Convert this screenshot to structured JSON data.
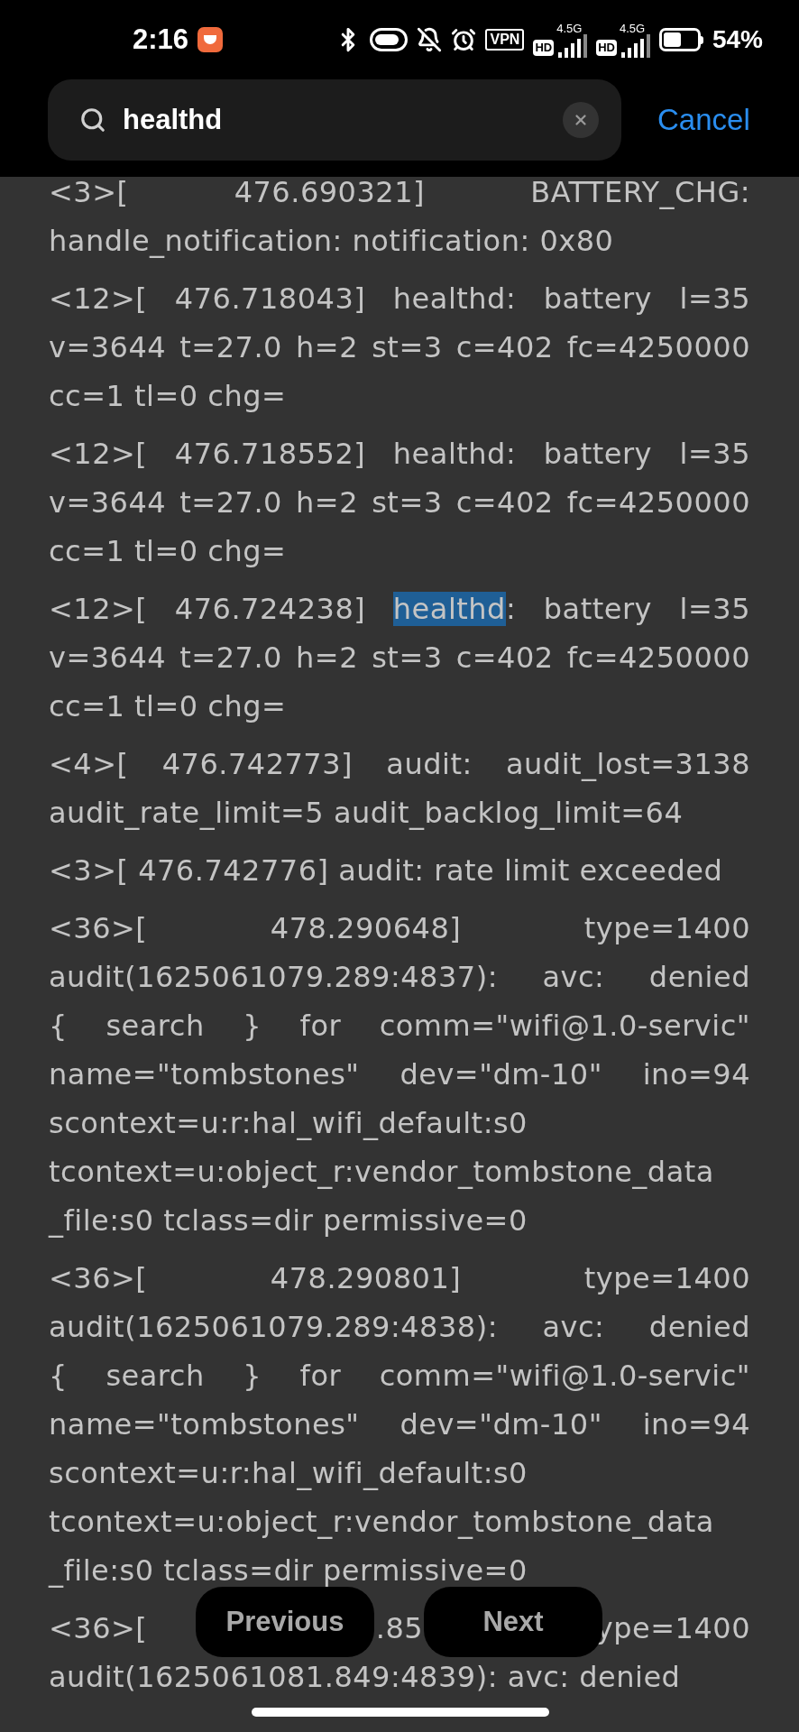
{
  "status_bar": {
    "time": "2:16",
    "vpn": "VPN",
    "sims": [
      {
        "hd": "HD",
        "network": "4.5G"
      },
      {
        "hd": "HD",
        "network": "4.5G"
      }
    ],
    "battery": "54%"
  },
  "search": {
    "value": "healthd",
    "cancel": "Cancel"
  },
  "entries": [
    {
      "lines": [
        "<3>[          476.690321]     BATTERY_CHG:",
        "handle_notification: notification: 0x80"
      ]
    },
    {
      "lines": [
        "<12>[     476.718043] healthd: battery l=35",
        "v=3644 t=27.0 h=2 st=3 c=402 fc=4250000",
        "cc=1 tl=0 chg="
      ]
    },
    {
      "lines": [
        "<12>[     476.718552] healthd: battery l=35",
        "v=3644 t=27.0 h=2 st=3 c=402 fc=4250000",
        "cc=1 tl=0 chg="
      ]
    },
    {
      "lines": [
        {
          "segments": [
            {
              "text": "<12>[     476.724238] ",
              "highlighted": false
            },
            {
              "text": "healthd",
              "highlighted": true
            },
            {
              "text": ": battery l=35",
              "highlighted": false
            }
          ]
        },
        "v=3644 t=27.0 h=2 st=3 c=402 fc=4250000",
        "cc=1 tl=0 chg="
      ]
    },
    {
      "lines": [
        "<4>[     476.742773] audit: audit_lost=3138",
        "audit_rate_limit=5 audit_backlog_limit=64"
      ]
    },
    {
      "lines": [
        "<3>[   476.742776] audit: rate limit exceeded"
      ]
    },
    {
      "lines": [
        "<36>[          478.290648]          type=1400",
        "audit(1625061079.289:4837): avc: denied",
        "{ search } for comm=\"wifi@1.0-servic\"",
        "name=\"tombstones\" dev=\"dm-10\" ino=94",
        "scontext=u:r:hal_wifi_default:s0",
        "tcontext=u:object_r:vendor_tombstone_data",
        "_file:s0 tclass=dir permissive=0"
      ]
    },
    {
      "lines": [
        "<36>[          478.290801]          type=1400",
        "audit(1625061079.289:4838): avc: denied",
        "{ search } for comm=\"wifi@1.0-servic\"",
        "name=\"tombstones\" dev=\"dm-10\" ino=94",
        "scontext=u:r:hal_wifi_default:s0",
        "tcontext=u:object_r:vendor_tombstone_data",
        "_file:s0 tclass=dir permissive=0"
      ]
    },
    {
      "lines": [
        {
          "fragments": [
            "<36>[",
            ".85",
            "ype=1400"
          ]
        },
        "audit(1625061081.849:4839): avc: denied"
      ]
    }
  ],
  "buttons": {
    "previous": "Previous",
    "next": "Next"
  }
}
